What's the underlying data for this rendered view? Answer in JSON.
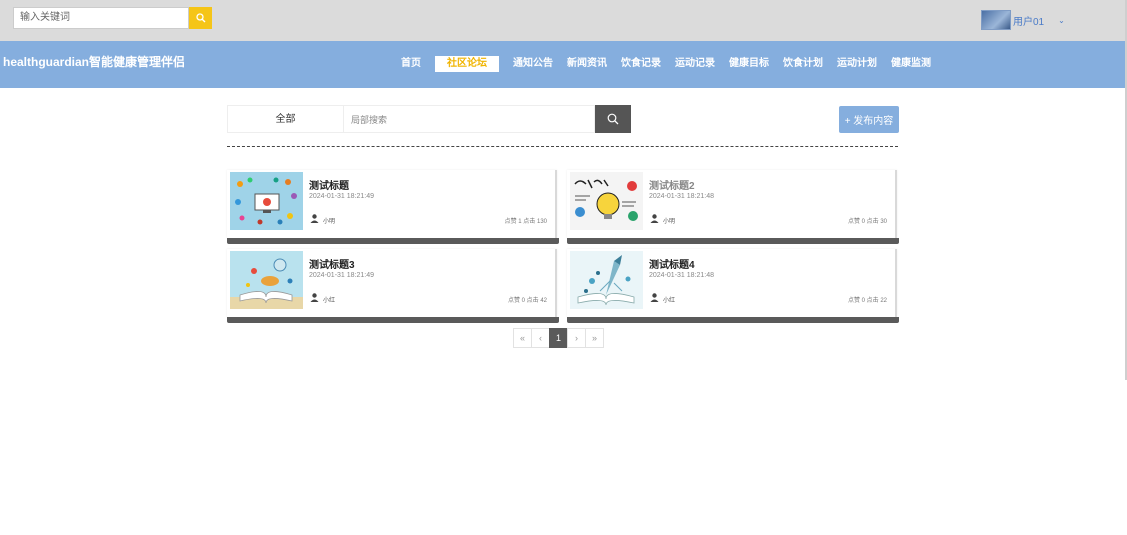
{
  "topbar": {
    "search_placeholder": "输入关键词",
    "user_name": "用户01",
    "user_caret": "⌄"
  },
  "navbar": {
    "brand": "healthguardian智能健康管理伴侣",
    "items": [
      "首页",
      "社区论坛",
      "通知公告",
      "新闻资讯",
      "饮食记录",
      "运动记录",
      "健康目标",
      "饮食计划",
      "运动计划",
      "健康监测"
    ],
    "active_index": 1
  },
  "filter": {
    "category": "全部",
    "local_search_placeholder": "局部搜索",
    "publish_label": "+ 发布内容"
  },
  "posts": [
    {
      "title": "测试标题",
      "time": "2024-01-31 18:21:49",
      "author": "小明",
      "stats": "点赞 1   点击 130",
      "thumb": "icons-collage"
    },
    {
      "title": "测试标题2",
      "time": "2024-01-31 18:21:48",
      "author": "小明",
      "stats": "点赞 0   点击 30",
      "thumb": "learn-doodle"
    },
    {
      "title": "测试标题3",
      "time": "2024-01-31 18:21:49",
      "author": "小红",
      "stats": "点赞 0   点击 42",
      "thumb": "open-book"
    },
    {
      "title": "测试标题4",
      "time": "2024-01-31 18:21:48",
      "author": "小红",
      "stats": "点赞 0   点击 22",
      "thumb": "book-rocket"
    }
  ],
  "pagination": {
    "first": "«",
    "prev": "‹",
    "current": "1",
    "next": "›",
    "last": "»"
  },
  "colors": {
    "nav_bg": "#85aede",
    "active_nav_text": "#f0b400",
    "search_btn": "#f5c518",
    "dark_btn": "#555555"
  }
}
